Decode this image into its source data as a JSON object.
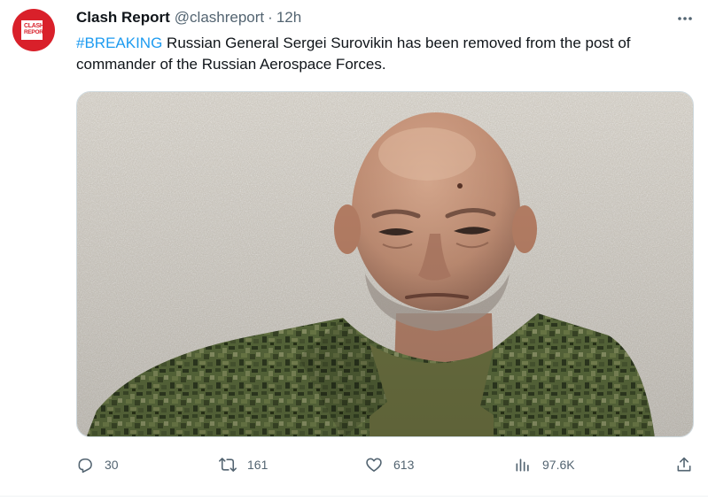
{
  "tweet": {
    "author": {
      "name": "Clash Report",
      "handle": "@clashreport",
      "separator": "·",
      "time": "12h",
      "avatar_text_top": "CLASH",
      "avatar_text_bottom": "REPORT"
    },
    "hashtag": "#BREAKING",
    "body": " Russian General Sergei Surovikin has been removed from the post of commander of the Russian Aerospace Forces.",
    "actions": {
      "replies": "30",
      "retweets": "161",
      "likes": "613",
      "views": "97.6K"
    }
  },
  "icons": {
    "more": "more-icon",
    "reply": "reply-icon",
    "retweet": "retweet-icon",
    "like": "heart-icon",
    "views": "views-icon",
    "share": "share-icon"
  },
  "colors": {
    "accent": "#1d9bf0",
    "text": "#0f1419",
    "secondary": "#536471",
    "avatar_bg": "#d9202a"
  }
}
